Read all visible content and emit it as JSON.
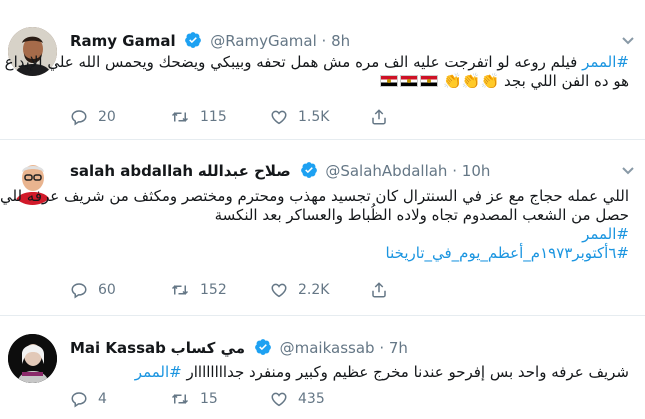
{
  "tweets": [
    {
      "name": "Ramy Gamal",
      "handle": "@RamyGamal",
      "dot": "·",
      "time": "8h",
      "lines": [
        {
          "tag": "#الممر",
          "text": " فيلم روعه لو اتفرجت عليه الف مره مش همل تحفه وبيبكي ويضحك ويحمس الله علي الإبداع"
        },
        {
          "tag": "",
          "text": "هو ده الفن اللي بجد 👏👏👏"
        }
      ],
      "flags": 3,
      "replies": "20",
      "retweets": "115",
      "likes": "1.5K"
    },
    {
      "name": "salah abdallah",
      "name_ar": "صلاح عبدالله",
      "handle": "@SalahAbdallah",
      "dot": "·",
      "time": "10h",
      "lines": [
        {
          "tag": "",
          "text": "اللي عمله حجاج مع عز في السنترال كان تجسيد مهذب ومحترم ومختصر ومكثف من شريف عرفه للي"
        },
        {
          "tag": "",
          "text": "حصل من الشعب المصدوم تجاه ولاده الظُباط والعساكر بعد النكسة"
        },
        {
          "tag": "#الممر",
          "text": ""
        },
        {
          "tag": "#٦أكتوبر١٩٧٣م_أعظم_يوم_في_تاريخنا",
          "text": ""
        }
      ],
      "replies": "60",
      "retweets": "152",
      "likes": "2.2K"
    },
    {
      "name": "Mai Kassab",
      "name_ar": "مي كساب",
      "handle": "@maikassab",
      "dot": "·",
      "time": "7h",
      "lines": [
        {
          "tag": "",
          "text": "شريف عرفه واحد بس إفرحو عندنا مخرج عظيم وكبير ومنفرد جداااااااار ",
          "tag_after": "#الممر"
        }
      ],
      "replies": "4",
      "retweets": "15",
      "likes": "435"
    }
  ],
  "colors": {
    "link": "#1b95e0",
    "muted": "#657786",
    "verified": "#1da1f2",
    "border": "#e6ecf0"
  }
}
